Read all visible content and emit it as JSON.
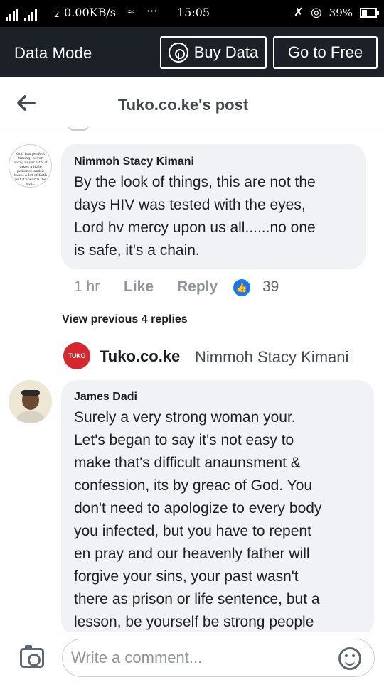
{
  "status_bar": {
    "carrier_left": "2",
    "data_speed": "0.00KB/s",
    "dots": "···",
    "time": "15:05",
    "battery": "39%"
  },
  "data_mode": {
    "label": "Data Mode",
    "buy_data": "Buy Data",
    "go_to_free": "Go to Free"
  },
  "header": {
    "title": "Tuko.co.ke's post"
  },
  "comments": [
    {
      "author": "Nimmoh Stacy Kimani",
      "text": "By the look of things, this are not the\ndays HIV was tested with the eyes,\nLord hv mercy upon us all......no one\nis safe, it's a chain.",
      "time": "1 hr",
      "like": "Like",
      "reply": "Reply",
      "reactions": "39",
      "avatar_text": "God has perfect timing; never early, never late. It takes a little patience and it takes a lot of faith but it's worth the wait."
    },
    {
      "author": "James Dadi",
      "text": "Surely a very strong woman your.\nLet's began to say it's not easy to\nmake that's difficult anaunsment &\nconfession, its by greac of God. You\ndon't need to apologize to every body\nyou infected, but you have to repent\nen pray and our heavenly father will\nforgive your sins, your past wasn't\nthere as prison or life sentence, but a\nlesson, be yourself be strong people"
    }
  ],
  "replies": {
    "view_previous": "View previous 4 replies",
    "logo": "TUKO",
    "author": "Tuko.co.ke",
    "preview": "Nimmoh Stacy Kimani"
  },
  "composer": {
    "placeholder": "Write a comment..."
  }
}
